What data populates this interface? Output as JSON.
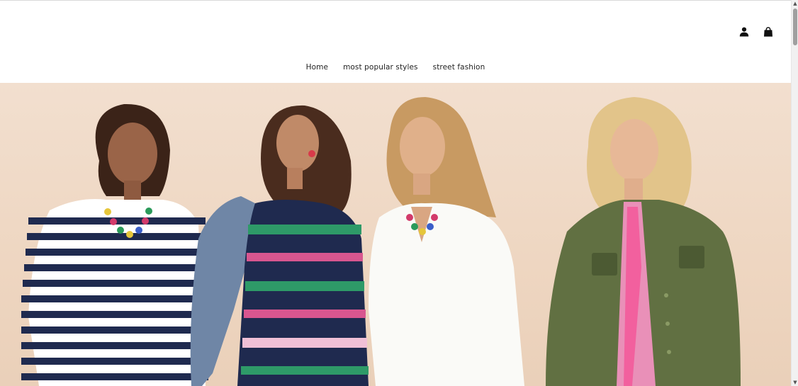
{
  "header": {
    "icons": {
      "account": "user-icon",
      "cart": "shopping-bag-icon"
    }
  },
  "nav": {
    "items": [
      {
        "label": "Home"
      },
      {
        "label": "most popular styles"
      },
      {
        "label": "street fashion"
      }
    ]
  },
  "colors": {
    "background": "#ffffff",
    "nav_text": "#222222",
    "hero_backdrop": "#f0dac6"
  }
}
